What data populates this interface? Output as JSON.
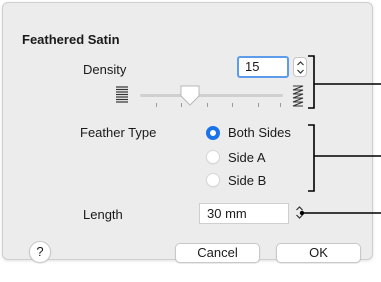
{
  "dialog": {
    "title": "Feathered Satin",
    "density": {
      "label": "Density",
      "value": "15",
      "slider_fraction": 0.35
    },
    "feather_type": {
      "label": "Feather Type",
      "options": [
        "Both Sides",
        "Side A",
        "Side B"
      ],
      "selected": "Both Sides"
    },
    "length": {
      "label": "Length",
      "value": "30 mm"
    },
    "buttons": {
      "help": "?",
      "cancel": "Cancel",
      "ok": "OK"
    }
  },
  "colors": {
    "accent": "#1a73e8",
    "focus_ring": "#5d9cec",
    "dialog_bg": "#ececec"
  }
}
